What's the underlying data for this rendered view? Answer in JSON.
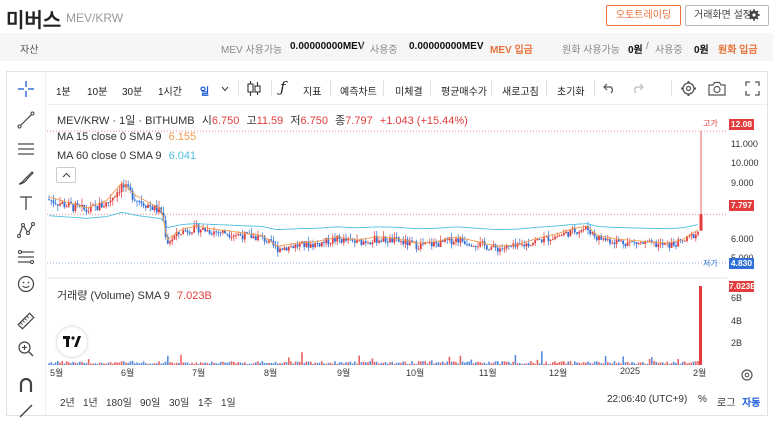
{
  "header": {
    "coin_name": "미버스",
    "pair": "MEV/KRW",
    "auto_trading_label": "오토트레이딩",
    "settings_label": "거래화면 설정"
  },
  "asset_bar": {
    "asset_label": "자산",
    "mev_available_label": "MEV 사용가능",
    "mev_available_value": "0.00000000MEV",
    "in_use_label": "사용중",
    "mev_in_use_value": "0.00000000MEV",
    "mev_deposit_label": "MEV 입금",
    "krw_available_label": "원화 사용가능",
    "krw_available_value": "0원",
    "krw_in_use_value": "0원",
    "krw_deposit_label": "원화 입금"
  },
  "toolbar": {
    "intervals": [
      "1분",
      "10분",
      "30분",
      "1시간",
      "일"
    ],
    "active_interval": "일",
    "indicator_label": "지표",
    "prediction_label": "예측차트",
    "unfilled_label": "미체결",
    "avg_price_label": "평균매수가",
    "refresh_label": "새로고침",
    "reset_label": "초기화"
  },
  "legend": {
    "title": "MEV/KRW · 1일 · BITHUMB",
    "open_label": "시",
    "open": "6.750",
    "high_label": "고",
    "high": "11.59",
    "low_label": "저",
    "low": "6.750",
    "close_label": "종",
    "close": "7.797",
    "change": "+1.043 (+15.44%)",
    "ma15_label": "MA 15 close 0 SMA 9",
    "ma15_value": "6.155",
    "ma60_label": "MA 60 close 0 SMA 9",
    "ma60_value": "6.041",
    "volume_label": "거래량 (Volume) SMA 9",
    "volume_value": "7.023B"
  },
  "price_axis": {
    "ticks": [
      "11.000",
      "10.000",
      "9.000",
      "8.000",
      "6.000",
      "5.000"
    ],
    "high_label": "고가",
    "high_tag": "12.08",
    "current_tag": "7.797",
    "low_label": "저가",
    "low_tag": "4.830"
  },
  "volume_axis": {
    "tag": "7.023B",
    "ticks": [
      "6B",
      "4B",
      "2B"
    ]
  },
  "time_axis": [
    "5월",
    "6월",
    "7월",
    "8월",
    "9월",
    "10월",
    "11월",
    "12월",
    "2025",
    "2월"
  ],
  "bottom": {
    "ranges": [
      "2년",
      "1년",
      "180일",
      "90일",
      "30일",
      "1주",
      "1일"
    ],
    "clock": "22:06:40 (UTC+9)",
    "percent": "%",
    "log": "로그",
    "auto": "자동"
  },
  "colors": {
    "up": "#e23c3c",
    "down": "#2f6fd6",
    "accent": "#e8733a",
    "active": "#1a5bd8",
    "ma15": "#f29b4c",
    "ma60": "#4cc1e0"
  }
}
